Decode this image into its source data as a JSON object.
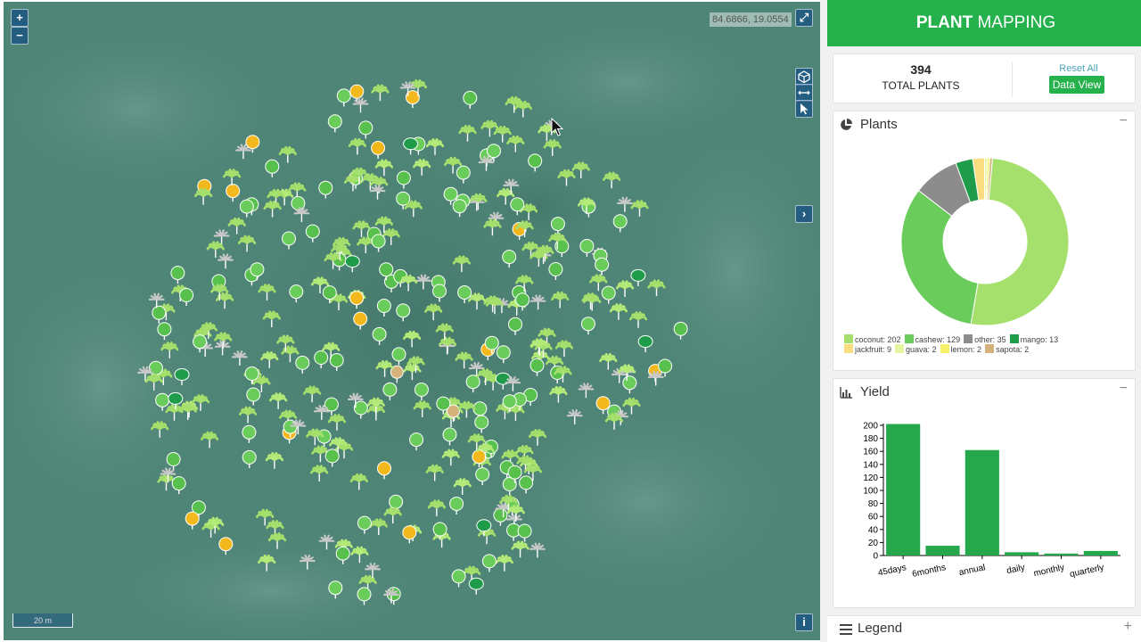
{
  "map": {
    "zoom_in_label": "+",
    "zoom_out_label": "−",
    "coords": "84.6866, 19.0554",
    "fullscreen_label": "⤢",
    "scale_label": "20 m",
    "info_label": "i",
    "expand_label": "›"
  },
  "header": {
    "title_bold": "PLANT",
    "title_rest": " MAPPING"
  },
  "totals": {
    "count": "394",
    "label": "TOTAL PLANTS",
    "reset_label": "Reset All",
    "data_view_label": "Data View"
  },
  "plants_panel": {
    "title": "Plants",
    "toggle": "−",
    "legend": [
      {
        "label": "coconut: 202",
        "color": "#a6e06c"
      },
      {
        "label": "cashew: 129",
        "color": "#6acc5a"
      },
      {
        "label": "other: 35",
        "color": "#8c8c8c"
      },
      {
        "label": "mango: 13",
        "color": "#1f9c4a"
      },
      {
        "label": "jackfruit: 9",
        "color": "#f9dd80"
      },
      {
        "label": "guava: 2",
        "color": "#e6f5a0"
      },
      {
        "label": "lemon: 2",
        "color": "#f6f06a"
      },
      {
        "label": "sapota: 2",
        "color": "#d4b27a"
      }
    ]
  },
  "yield_panel": {
    "title": "Yield",
    "toggle": "−"
  },
  "legend_panel": {
    "title": "Legend",
    "toggle": "+"
  },
  "chart_data": [
    {
      "type": "pie",
      "title": "",
      "categories": [
        "coconut",
        "cashew",
        "other",
        "mango",
        "jackfruit",
        "guava",
        "lemon",
        "sapota"
      ],
      "values": [
        202,
        129,
        35,
        13,
        9,
        2,
        2,
        2
      ],
      "colors": [
        "#a6e06c",
        "#6acc5a",
        "#8c8c8c",
        "#1f9c4a",
        "#f9dd80",
        "#e6f5a0",
        "#f6f06a",
        "#d4b27a"
      ]
    },
    {
      "type": "bar",
      "title": "",
      "categories": [
        "45days",
        "6months",
        "annual",
        "daily",
        "monthly",
        "quarterly"
      ],
      "values": [
        202,
        15,
        162,
        5,
        3,
        7
      ],
      "ylim": [
        0,
        200
      ],
      "yticks": [
        0,
        20,
        40,
        60,
        80,
        100,
        120,
        140,
        160,
        180,
        200
      ],
      "color": "#25a84c",
      "xlabel": "",
      "ylabel": ""
    }
  ]
}
